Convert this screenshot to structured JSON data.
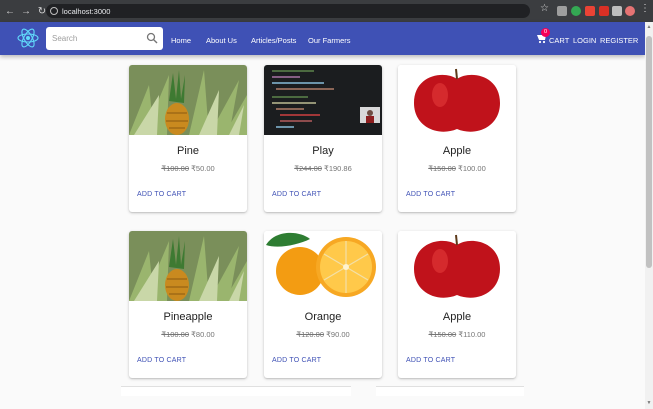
{
  "browser": {
    "url": "localhost:3000",
    "icons": [
      "back-icon",
      "forward-icon",
      "reload-icon",
      "info-icon",
      "star-icon",
      "menu-icon"
    ]
  },
  "appbar": {
    "search_placeholder": "Search",
    "nav": [
      "Home",
      "About Us",
      "Articles/Posts",
      "Our Farmers"
    ],
    "cart_count": "0",
    "cart_label": "CART",
    "login_label": "LOGIN",
    "register_label": "REGISTER",
    "colors": {
      "appbar": "#3f51b5",
      "badge": "#f50057",
      "accent": "#3f51b5"
    }
  },
  "products": [
    {
      "name": "Pine",
      "old_price": "₹100.00",
      "new_price": "₹50.00",
      "button": "ADD TO CART",
      "image": "pineapple"
    },
    {
      "name": "Play",
      "old_price": "₹244.00",
      "new_price": "₹190.86",
      "button": "ADD TO CART",
      "image": "code-screenshot"
    },
    {
      "name": "Apple",
      "old_price": "₹150.00",
      "new_price": "₹100.00",
      "button": "ADD TO CART",
      "image": "apple"
    },
    {
      "name": "Pineapple",
      "old_price": "₹100.00",
      "new_price": "₹80.00",
      "button": "ADD TO CART",
      "image": "pineapple"
    },
    {
      "name": "Orange",
      "old_price": "₹120.00",
      "new_price": "₹90.00",
      "button": "ADD TO CART",
      "image": "orange"
    },
    {
      "name": "Apple",
      "old_price": "₹150.00",
      "new_price": "₹110.00",
      "button": "ADD TO CART",
      "image": "apple"
    }
  ]
}
